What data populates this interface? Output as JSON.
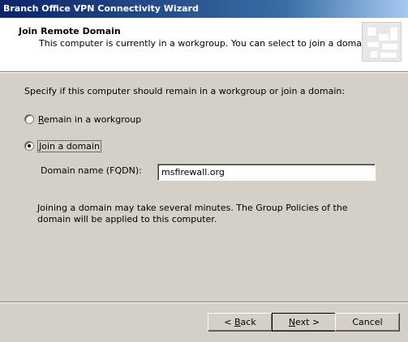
{
  "window": {
    "title": "Branch Office VPN Connectivity Wizard"
  },
  "header": {
    "title": "Join Remote Domain",
    "subtitle": "This computer is currently in a workgroup. You can select to join a domain."
  },
  "body": {
    "prompt": "Specify if this computer should remain in a workgroup or join a domain:",
    "options": [
      {
        "label_access_key": "R",
        "label_rest": "emain in a workgroup",
        "selected": false
      },
      {
        "label_access_key": "J",
        "label_rest": "oin a domain",
        "selected": true
      }
    ],
    "domain_field": {
      "label": "Domain name (FQDN):",
      "value": "msfirewall.org"
    },
    "info": "Joining a domain may take several minutes. The Group Policies of the domain will be applied to this computer."
  },
  "buttons": {
    "back": {
      "prefix": "< ",
      "access_key": "B",
      "rest": "ack"
    },
    "next": {
      "access_key": "N",
      "rest": "ext >"
    },
    "cancel": "Cancel"
  }
}
